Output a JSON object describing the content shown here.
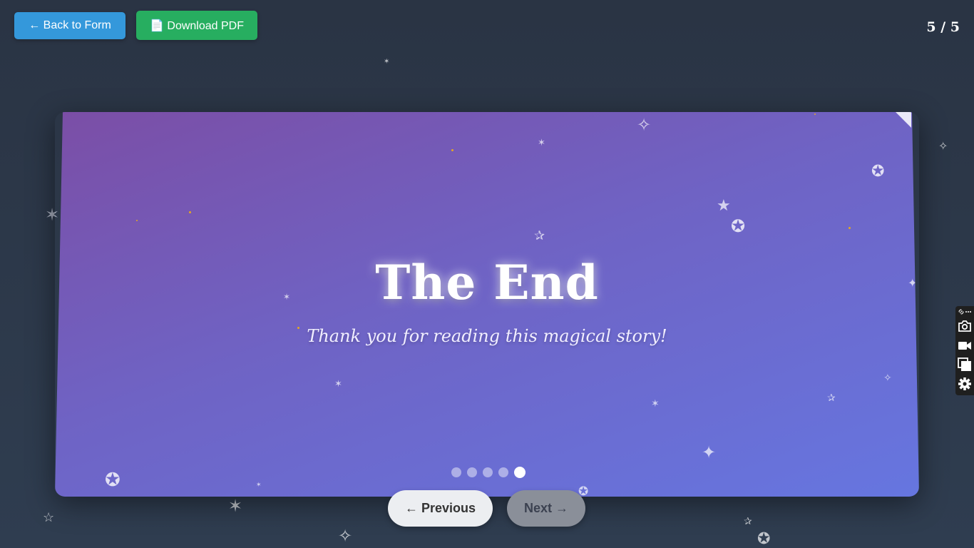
{
  "toolbar": {
    "back_label": "← Back to Form",
    "pdf_label": "📄 Download PDF"
  },
  "page_counter": "5 / 5",
  "slide": {
    "title": "The End",
    "subtitle": "Thank you for reading this magical story!",
    "dots": {
      "total": 5,
      "active": 5
    }
  },
  "nav": {
    "previous_label": "← Previous",
    "next_label": "Next →"
  },
  "colors": {
    "back_button": "#3498db",
    "pdf_button": "#27ae60",
    "slide_gradient_start": "#7b4ea6",
    "slide_gradient_end": "#6676e0",
    "background": "#2c3a4c"
  },
  "side_toolbar": {
    "icons": [
      "link-icon",
      "more-icon",
      "camera-icon",
      "video-icon",
      "copy-icon",
      "gear-icon"
    ]
  }
}
